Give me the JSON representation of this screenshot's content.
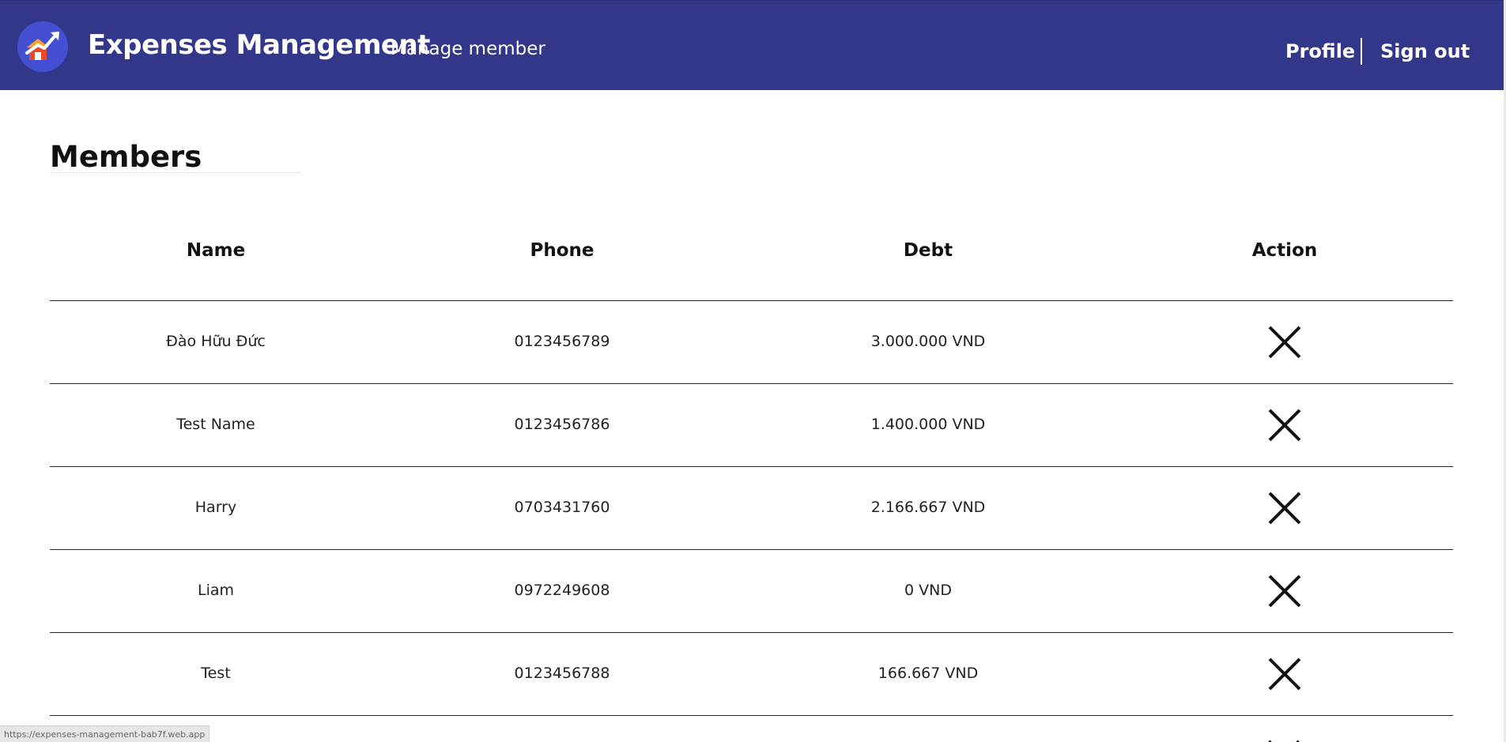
{
  "header": {
    "brand": "Expenses Management",
    "subtitle": "Manage member",
    "profile_label": "Profile",
    "signout_label": "Sign out",
    "background_color": "#32378a",
    "logo_icon": "house-with-arrow-logo"
  },
  "page": {
    "title": "Members"
  },
  "table": {
    "columns": [
      "Name",
      "Phone",
      "Debt",
      "Action"
    ],
    "rows": [
      {
        "name": "Đào Hữu Đức",
        "phone": "0123456789",
        "debt": "3.000.000 VND",
        "action_icon": "close-icon"
      },
      {
        "name": "Test Name",
        "phone": "0123456786",
        "debt": "1.400.000 VND",
        "action_icon": "close-icon"
      },
      {
        "name": "Harry",
        "phone": "0703431760",
        "debt": "2.166.667 VND",
        "action_icon": "close-icon"
      },
      {
        "name": "Liam",
        "phone": "0972249608",
        "debt": "0 VND",
        "action_icon": "close-icon"
      },
      {
        "name": "Test",
        "phone": "0123456788",
        "debt": "166.667 VND",
        "action_icon": "close-icon"
      }
    ]
  },
  "status_bar": {
    "url": "https://expenses-management-bab7f.web.app"
  }
}
